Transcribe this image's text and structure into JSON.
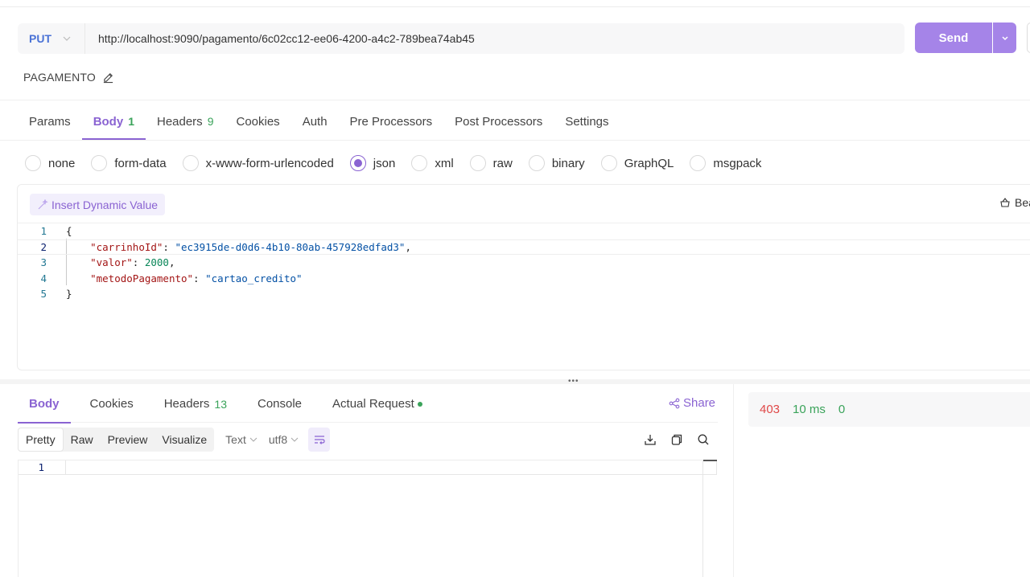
{
  "request": {
    "method": "PUT",
    "url": "http://localhost:9090/pagamento/6c02cc12-ee06-4200-a4c2-789bea74ab45",
    "send_label": "Send",
    "name": "PAGAMENTO"
  },
  "tabs": [
    {
      "label": "Params",
      "count": ""
    },
    {
      "label": "Body",
      "count": "1"
    },
    {
      "label": "Headers",
      "count": "9"
    },
    {
      "label": "Cookies",
      "count": ""
    },
    {
      "label": "Auth",
      "count": ""
    },
    {
      "label": "Pre Processors",
      "count": ""
    },
    {
      "label": "Post Processors",
      "count": ""
    },
    {
      "label": "Settings",
      "count": ""
    }
  ],
  "body_types": [
    "none",
    "form-data",
    "x-www-form-urlencoded",
    "json",
    "xml",
    "raw",
    "binary",
    "GraphQL",
    "msgpack"
  ],
  "body_type_selected": "json",
  "editor": {
    "dynamic_value_label": "Insert Dynamic Value",
    "beautify_label": "Bea",
    "line_numbers": [
      "1",
      "2",
      "3",
      "4",
      "5"
    ],
    "lines": {
      "l1": "{",
      "l2_key": "\"carrinhoId\"",
      "l2_val": "\"ec3915de-d0d6-4b10-80ab-457928edfad3\"",
      "l3_key": "\"valor\"",
      "l3_val": "2000",
      "l4_key": "\"metodoPagamento\"",
      "l4_val": "\"cartao_credito\"",
      "l5": "}"
    }
  },
  "response": {
    "tabs": [
      {
        "label": "Body",
        "count": ""
      },
      {
        "label": "Cookies",
        "count": ""
      },
      {
        "label": "Headers",
        "count": "13"
      },
      {
        "label": "Console",
        "count": ""
      },
      {
        "label": "Actual Request",
        "count": ""
      }
    ],
    "share_label": "Share",
    "view_options": [
      "Pretty",
      "Raw",
      "Preview",
      "Visualize"
    ],
    "view_selected": "Pretty",
    "format_select": "Text",
    "encoding_select": "utf8",
    "line_numbers": [
      "1"
    ],
    "status_code": "403",
    "time": "10 ms",
    "size": "0"
  },
  "colors": {
    "accent": "#8a63d2",
    "send": "#a584e8",
    "method": "#4a72d6",
    "success": "#3aa35a",
    "error": "#e04848"
  },
  "icons": [
    "chevron-down-icon",
    "pencil-icon",
    "magic-wand-icon",
    "beautify-icon",
    "share-icon",
    "wrap-icon",
    "download-icon",
    "copy-icon",
    "search-icon"
  ]
}
